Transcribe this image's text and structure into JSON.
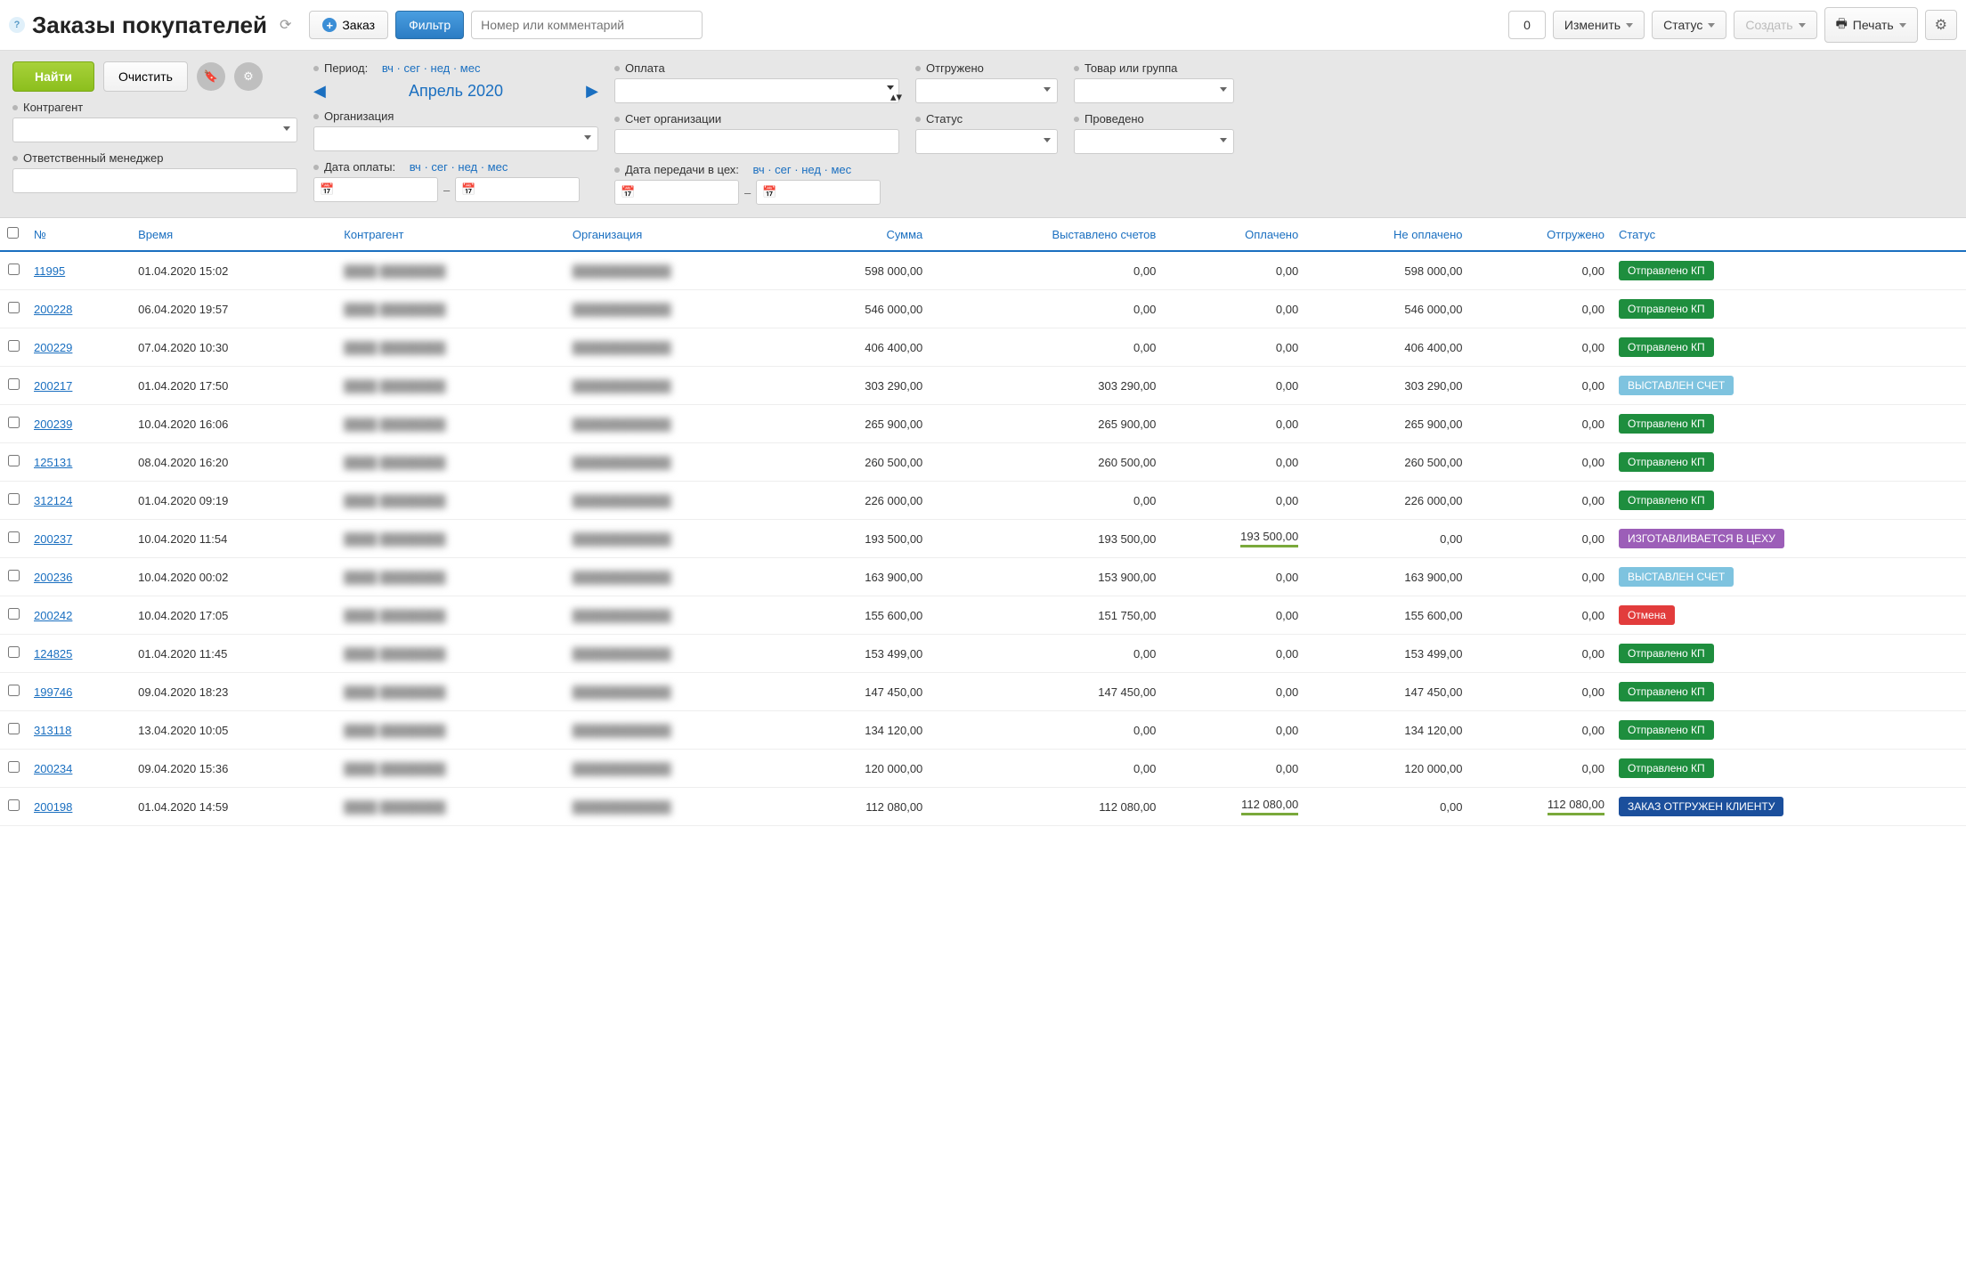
{
  "toolbar": {
    "title": "Заказы покупателей",
    "new_order": "Заказ",
    "filter": "Фильтр",
    "search_placeholder": "Номер или комментарий",
    "count": "0",
    "change": "Изменить",
    "status": "Статус",
    "create": "Создать",
    "print": "Печать"
  },
  "filters": {
    "find": "Найти",
    "clear": "Очистить",
    "counterparty": "Контрагент",
    "responsible": "Ответственный менеджер",
    "period_label": "Период:",
    "period_links": "вч · сег · нед · мес",
    "period_current": "Апрель 2020",
    "organization": "Организация",
    "payment_date": "Дата оплаты:",
    "payment": "Оплата",
    "org_account": "Счет организации",
    "workshop_date": "Дата передачи в цех:",
    "shipped": "Отгружено",
    "status_label": "Статус",
    "product_group": "Товар или группа",
    "posted": "Проведено"
  },
  "columns": {
    "no": "№",
    "time": "Время",
    "counterparty": "Контрагент",
    "organization": "Организация",
    "sum": "Сумма",
    "invoiced": "Выставлено счетов",
    "paid": "Оплачено",
    "unpaid": "Не оплачено",
    "shipped": "Отгружено",
    "status": "Статус"
  },
  "status_labels": {
    "kp": "Отправлено КП",
    "invoice": "ВЫСТАВЛЕН СЧЕТ",
    "workshop": "ИЗГОТАВЛИВАЕТСЯ В ЦЕХУ",
    "cancel": "Отмена",
    "shipped_client": "ЗАКАЗ ОТГРУЖЕН КЛИЕНТУ"
  },
  "rows": [
    {
      "no": "11995",
      "time": "01.04.2020 15:02",
      "sum": "598 000,00",
      "invoiced": "0,00",
      "paid": "0,00",
      "unpaid": "598 000,00",
      "shipped": "0,00",
      "status": "kp"
    },
    {
      "no": "200228",
      "time": "06.04.2020 19:57",
      "sum": "546 000,00",
      "invoiced": "0,00",
      "paid": "0,00",
      "unpaid": "546 000,00",
      "shipped": "0,00",
      "status": "kp"
    },
    {
      "no": "200229",
      "time": "07.04.2020 10:30",
      "sum": "406 400,00",
      "invoiced": "0,00",
      "paid": "0,00",
      "unpaid": "406 400,00",
      "shipped": "0,00",
      "status": "kp"
    },
    {
      "no": "200217",
      "time": "01.04.2020 17:50",
      "sum": "303 290,00",
      "invoiced": "303 290,00",
      "paid": "0,00",
      "unpaid": "303 290,00",
      "shipped": "0,00",
      "status": "invoice"
    },
    {
      "no": "200239",
      "time": "10.04.2020 16:06",
      "sum": "265 900,00",
      "invoiced": "265 900,00",
      "paid": "0,00",
      "unpaid": "265 900,00",
      "shipped": "0,00",
      "status": "kp"
    },
    {
      "no": "125131",
      "time": "08.04.2020 16:20",
      "sum": "260 500,00",
      "invoiced": "260 500,00",
      "paid": "0,00",
      "unpaid": "260 500,00",
      "shipped": "0,00",
      "status": "kp"
    },
    {
      "no": "312124",
      "time": "01.04.2020 09:19",
      "sum": "226 000,00",
      "invoiced": "0,00",
      "paid": "0,00",
      "unpaid": "226 000,00",
      "shipped": "0,00",
      "status": "kp"
    },
    {
      "no": "200237",
      "time": "10.04.2020 11:54",
      "sum": "193 500,00",
      "invoiced": "193 500,00",
      "paid": "193 500,00",
      "unpaid": "0,00",
      "shipped": "0,00",
      "status": "workshop",
      "paid_full": true
    },
    {
      "no": "200236",
      "time": "10.04.2020 00:02",
      "sum": "163 900,00",
      "invoiced": "153 900,00",
      "paid": "0,00",
      "unpaid": "163 900,00",
      "shipped": "0,00",
      "status": "invoice"
    },
    {
      "no": "200242",
      "time": "10.04.2020 17:05",
      "sum": "155 600,00",
      "invoiced": "151 750,00",
      "paid": "0,00",
      "unpaid": "155 600,00",
      "shipped": "0,00",
      "status": "cancel"
    },
    {
      "no": "124825",
      "time": "01.04.2020 11:45",
      "sum": "153 499,00",
      "invoiced": "0,00",
      "paid": "0,00",
      "unpaid": "153 499,00",
      "shipped": "0,00",
      "status": "kp"
    },
    {
      "no": "199746",
      "time": "09.04.2020 18:23",
      "sum": "147 450,00",
      "invoiced": "147 450,00",
      "paid": "0,00",
      "unpaid": "147 450,00",
      "shipped": "0,00",
      "status": "kp"
    },
    {
      "no": "313118",
      "time": "13.04.2020 10:05",
      "sum": "134 120,00",
      "invoiced": "0,00",
      "paid": "0,00",
      "unpaid": "134 120,00",
      "shipped": "0,00",
      "status": "kp"
    },
    {
      "no": "200234",
      "time": "09.04.2020 15:36",
      "sum": "120 000,00",
      "invoiced": "0,00",
      "paid": "0,00",
      "unpaid": "120 000,00",
      "shipped": "0,00",
      "status": "kp"
    },
    {
      "no": "200198",
      "time": "01.04.2020 14:59",
      "sum": "112 080,00",
      "invoiced": "112 080,00",
      "paid": "112 080,00",
      "unpaid": "0,00",
      "shipped": "112 080,00",
      "status": "shipped_client",
      "paid_full": true,
      "shipped_full": true
    }
  ]
}
